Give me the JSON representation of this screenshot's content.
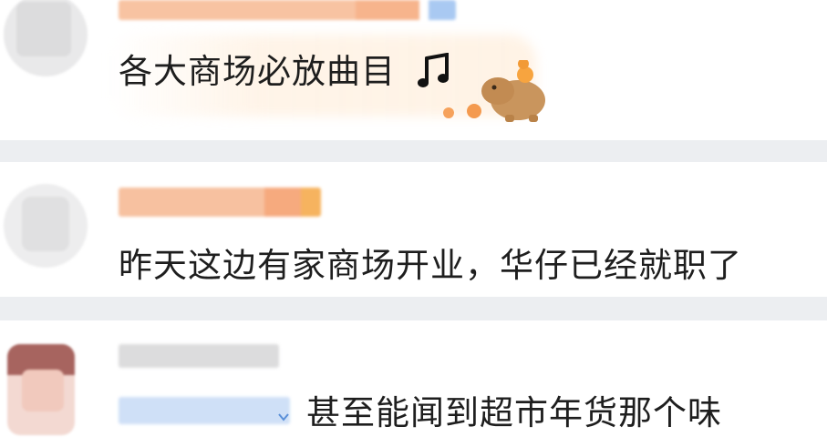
{
  "comments": [
    {
      "text": "各大商场必放曲目"
    },
    {
      "text": "昨天这边有家商场开业，华仔已经就职了"
    },
    {
      "text": "甚至能闻到超市年货那个味"
    }
  ],
  "icons": {
    "music": "music-note-icon",
    "sticker": "capybara-sticker-icon",
    "expand": "chevron-down-icon"
  },
  "colors": {
    "separator": "#eceef1",
    "text": "#1e1e1e",
    "name_orange": "#f6a36a",
    "name_blue": "#9cc3f5"
  }
}
